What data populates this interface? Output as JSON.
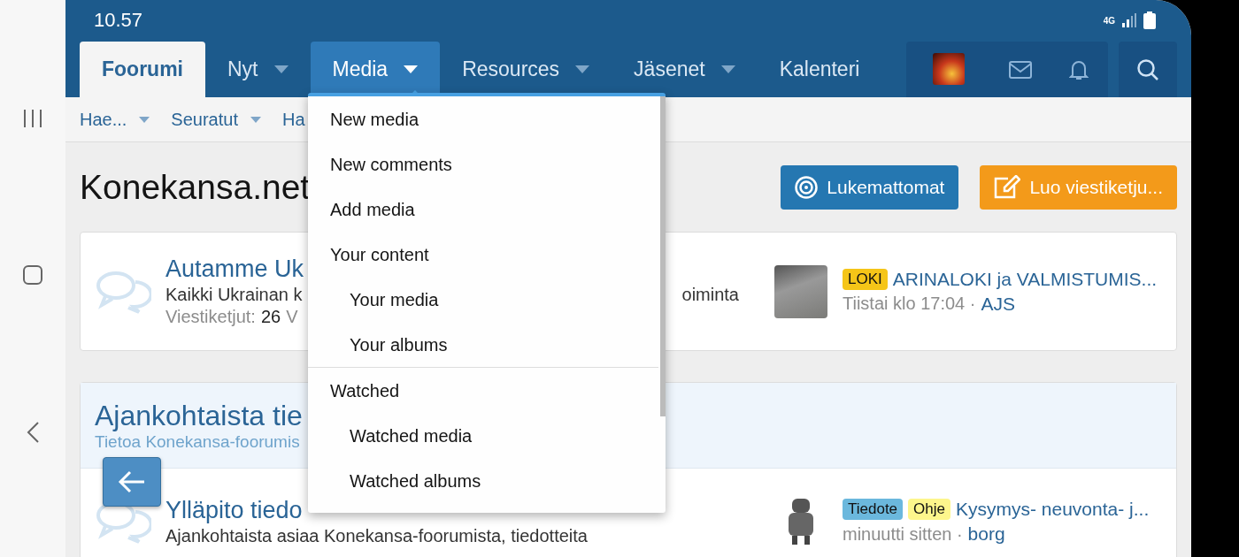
{
  "status_bar": {
    "time": "10.57",
    "network": "4G"
  },
  "nav_tabs": [
    {
      "label": "Foorumi",
      "selected": true,
      "has_menu": false,
      "expanded": false
    },
    {
      "label": "Nyt",
      "selected": false,
      "has_menu": true,
      "expanded": false
    },
    {
      "label": "Media",
      "selected": false,
      "has_menu": true,
      "expanded": true
    },
    {
      "label": "Resources",
      "selected": false,
      "has_menu": true,
      "expanded": false
    },
    {
      "label": "Jäsenet",
      "selected": false,
      "has_menu": true,
      "expanded": false
    },
    {
      "label": "Kalenteri",
      "selected": false,
      "has_menu": false,
      "expanded": false
    }
  ],
  "sub_nav": [
    {
      "label": "Hae...",
      "has_menu": true
    },
    {
      "label": "Seuratut",
      "has_menu": true
    },
    {
      "label": "Ha",
      "has_menu": false
    }
  ],
  "page_title": "Konekansa.net",
  "buttons": [
    {
      "label": "Lukemattomat",
      "kind": "primary"
    },
    {
      "label": "Luo viestiketju...",
      "kind": "cta"
    }
  ],
  "forum_card": {
    "title": "Autamme Uk",
    "description": "Kaikki Ukrainan k",
    "description_tail": "oiminta",
    "stats_label": "Viestiketjut:",
    "stats_value": "26",
    "stats_tail": "V",
    "latest": {
      "tags": [
        {
          "label": "LOKI",
          "color": "#f5c518"
        }
      ],
      "title": "ARINALOKI ja VALMISTUMIS...",
      "time": "Tiistai klo 17:04 ·",
      "author": "AJS"
    }
  },
  "category": {
    "title": "Ajankohtaista tie",
    "subtitle": "Tietoa Konekansa-foorumis",
    "forum": {
      "title": "Ylläpito tiedo",
      "description": "Ajankohtaista asiaa Konekansa-foorumista, tiedotteita",
      "latest": {
        "tags": [
          {
            "label": "Tiedote",
            "color": "#6bb8dd"
          },
          {
            "label": "Ohje",
            "color": "#fdf68c"
          }
        ],
        "title": "Kysymys- neuvonta- j...",
        "time": "minuutti sitten ·",
        "author": "borg"
      }
    }
  },
  "media_menu": [
    {
      "label": "New media",
      "separator_before": false
    },
    {
      "label": "New comments",
      "separator_before": false
    },
    {
      "label": "Add media",
      "separator_before": false
    },
    {
      "label": "Your content",
      "separator_before": false,
      "children": [
        {
          "label": "Your media"
        },
        {
          "label": "Your albums"
        }
      ]
    },
    {
      "label": "Watched",
      "separator_before": true,
      "children": [
        {
          "label": "Watched media"
        },
        {
          "label": "Watched albums"
        }
      ]
    }
  ]
}
